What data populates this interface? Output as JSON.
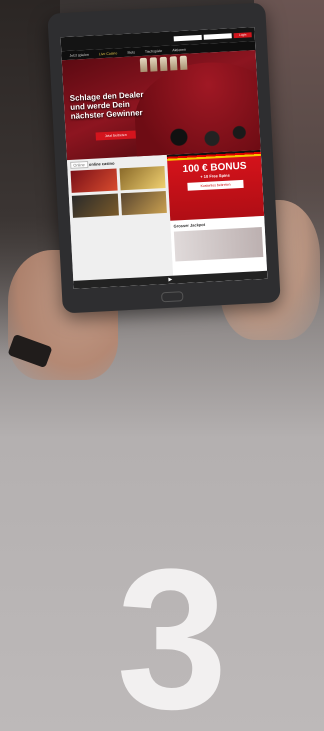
{
  "step": {
    "number": "3"
  },
  "screen": {
    "nav": [
      "Jetzt spielen",
      "Live Casino",
      "Slots",
      "Tischspiele",
      "Aktionen"
    ],
    "login_label": "Login",
    "hero": {
      "headline": "Schlage den Dealer und werde Dein nächster Gewinner",
      "button": "Jetzt beitreten"
    },
    "left": {
      "title_badge": "Online",
      "title": "online casino"
    },
    "promo": {
      "big": "100 € BONUS",
      "small": "+ 10 Free Spins",
      "button": "Kostenlos beitreten"
    },
    "section": "Grosser Jackpot"
  },
  "colors": {
    "accent": "#d4141d",
    "background": "#bdb9b9",
    "number": "#f2f0f0"
  }
}
